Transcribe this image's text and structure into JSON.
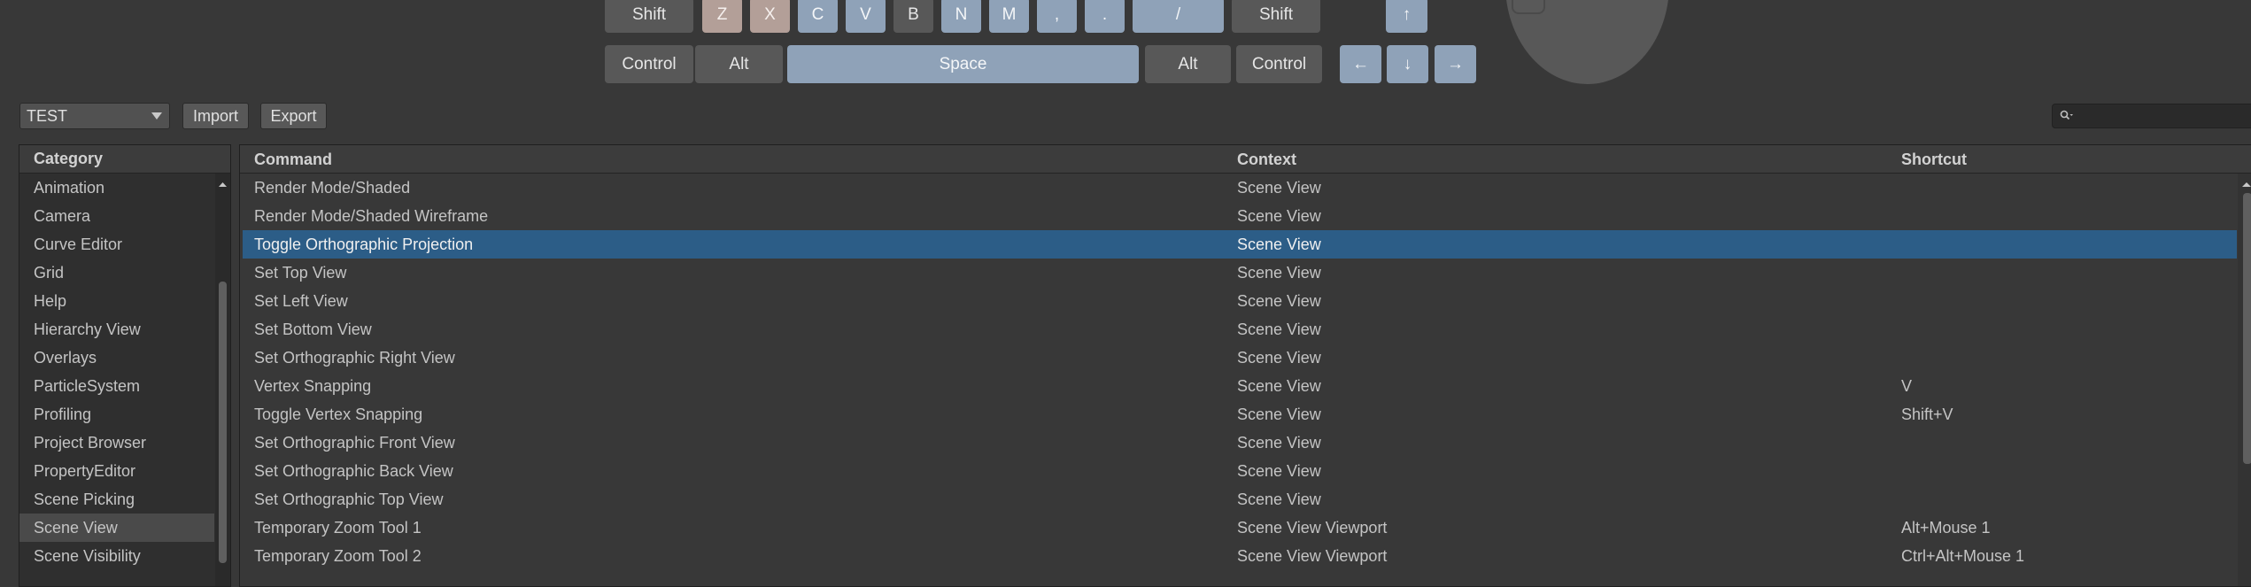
{
  "keyboard": {
    "row_shift": {
      "left_shift": "Shift",
      "keys": [
        "Z",
        "X",
        "C",
        "V",
        "B",
        "N",
        "M",
        ",",
        ".",
        "/"
      ],
      "right_shift": "Shift",
      "arrow_up": "↑"
    },
    "row_bottom": {
      "left_control": "Control",
      "left_alt": "Alt",
      "space": "Space",
      "right_alt": "Alt",
      "right_control": "Control",
      "arrow_left": "←",
      "arrow_down": "↓",
      "arrow_right": "→"
    },
    "colors": {
      "dark": "#585858",
      "assigned": "#8fa2b8",
      "modified": "#b39f98"
    }
  },
  "toolbar": {
    "profile_selected": "TEST",
    "import_label": "Import",
    "export_label": "Export",
    "search_value": ""
  },
  "category_panel": {
    "header": "Category",
    "items": [
      "Animation",
      "Camera",
      "Curve Editor",
      "Grid",
      "Help",
      "Hierarchy View",
      "Overlays",
      "ParticleSystem",
      "Profiling",
      "Project Browser",
      "PropertyEditor",
      "Scene Picking",
      "Scene View",
      "Scene Visibility"
    ],
    "selected": "Scene View"
  },
  "command_table": {
    "columns": [
      "Command",
      "Context",
      "Shortcut"
    ],
    "rows": [
      {
        "command": "Render Mode/Shaded",
        "context": "Scene View",
        "shortcut": ""
      },
      {
        "command": "Render Mode/Shaded Wireframe",
        "context": "Scene View",
        "shortcut": ""
      },
      {
        "command": "Toggle Orthographic Projection",
        "context": "Scene View",
        "shortcut": ""
      },
      {
        "command": "Set Top View",
        "context": "Scene View",
        "shortcut": ""
      },
      {
        "command": "Set Left View",
        "context": "Scene View",
        "shortcut": ""
      },
      {
        "command": "Set Bottom View",
        "context": "Scene View",
        "shortcut": ""
      },
      {
        "command": "Set Orthographic Right View",
        "context": "Scene View",
        "shortcut": ""
      },
      {
        "command": "Vertex Snapping",
        "context": "Scene View",
        "shortcut": "V"
      },
      {
        "command": "Toggle Vertex Snapping",
        "context": "Scene View",
        "shortcut": "Shift+V"
      },
      {
        "command": "Set Orthographic Front View",
        "context": "Scene View",
        "shortcut": ""
      },
      {
        "command": "Set Orthographic Back View",
        "context": "Scene View",
        "shortcut": ""
      },
      {
        "command": "Set Orthographic Top View",
        "context": "Scene View",
        "shortcut": ""
      },
      {
        "command": "Temporary Zoom Tool 1",
        "context": "Scene View Viewport",
        "shortcut": "Alt+Mouse 1"
      },
      {
        "command": "Temporary Zoom Tool 2",
        "context": "Scene View Viewport",
        "shortcut": "Ctrl+Alt+Mouse 1"
      }
    ],
    "selected_command": "Toggle Orthographic Projection",
    "selection_color": "#2c5d87"
  }
}
